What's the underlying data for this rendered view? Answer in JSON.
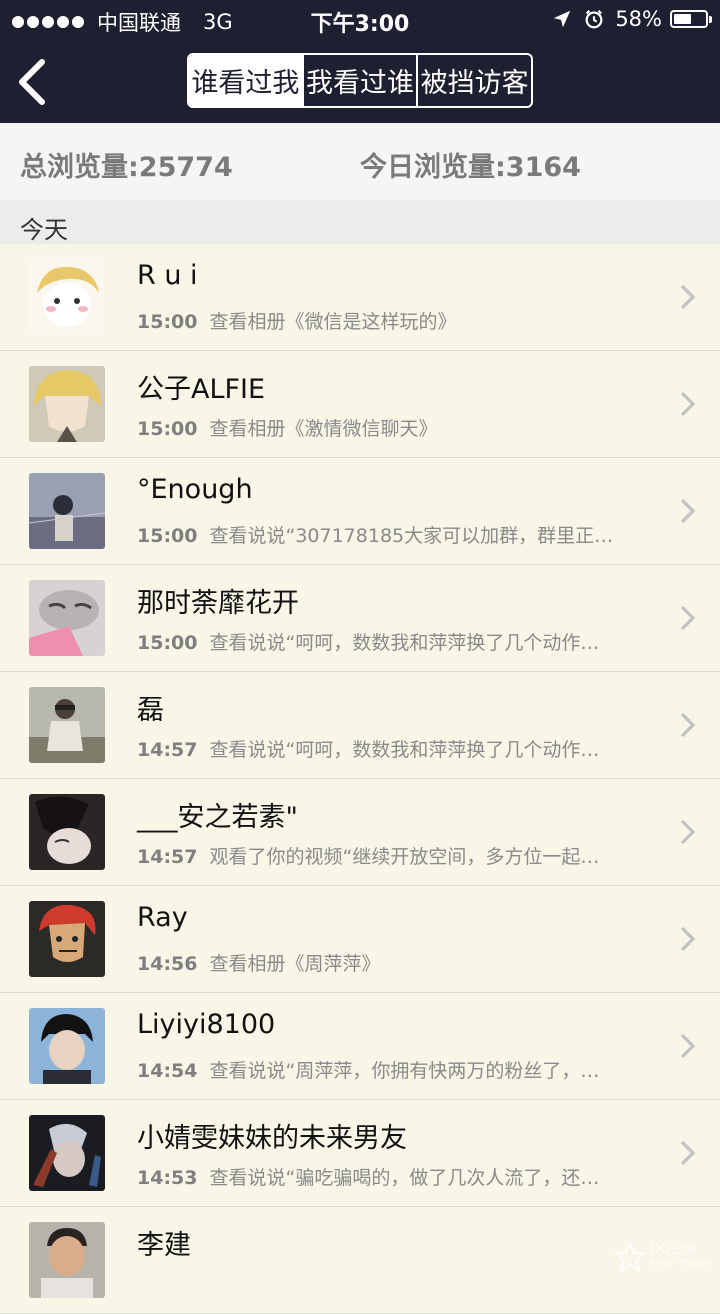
{
  "status_bar": {
    "carrier": "中国联通",
    "network": "3G",
    "time": "下午3:00",
    "battery": "58%",
    "battery_level": 0.58
  },
  "nav": {
    "back_icon": "chevron-left-icon",
    "tabs": [
      {
        "label": "谁看过我",
        "active": true
      },
      {
        "label": "我看过谁",
        "active": false
      },
      {
        "label": "被挡访客",
        "active": false
      }
    ]
  },
  "stats": {
    "total": "总浏览量:25774",
    "today": "今日浏览量:3164"
  },
  "section": {
    "title": "今天"
  },
  "visitors": [
    {
      "name": "R u i",
      "time": "15:00",
      "action": "查看相册《微信是这样玩的》",
      "avatar": "cartoon-blonde"
    },
    {
      "name": "公子ALFIE",
      "time": "15:00",
      "action": "查看相册《激情微信聊天》",
      "avatar": "anime-blonde"
    },
    {
      "name": "°Enough",
      "time": "15:00",
      "action": "查看说说“307178185大家可以加群，群里正…",
      "avatar": "field-girl"
    },
    {
      "name": "那时荼靡花开",
      "time": "15:00",
      "action": "查看说说“呵呵，数数我和萍萍换了几个动作…",
      "avatar": "blur-face"
    },
    {
      "name": "磊",
      "time": "14:57",
      "action": "查看说说“呵呵，数数我和萍萍换了几个动作…",
      "avatar": "man-field"
    },
    {
      "name": "___安之若素\"",
      "time": "14:57",
      "action": "观看了你的视频“继续开放空间，多方位一起…",
      "avatar": "dark-girl"
    },
    {
      "name": "Ray",
      "time": "14:56",
      "action": "查看相册《周萍萍》",
      "avatar": "red-hair-cartoon"
    },
    {
      "name": "Liyiyi8100",
      "time": "14:54",
      "action": "查看说说“周萍萍，你拥有快两万的粉丝了，…",
      "avatar": "young-man"
    },
    {
      "name": "小婧雯妹妹的未来男友",
      "time": "14:53",
      "action": "查看说说“骗吃骗喝的，做了几次人流了，还…",
      "avatar": "dark-hands"
    },
    {
      "name": "李建",
      "time": "",
      "action": "",
      "avatar": "man-portrait"
    }
  ],
  "watermark": {
    "title": "QQ空间",
    "subtitle": "from iPhone"
  }
}
